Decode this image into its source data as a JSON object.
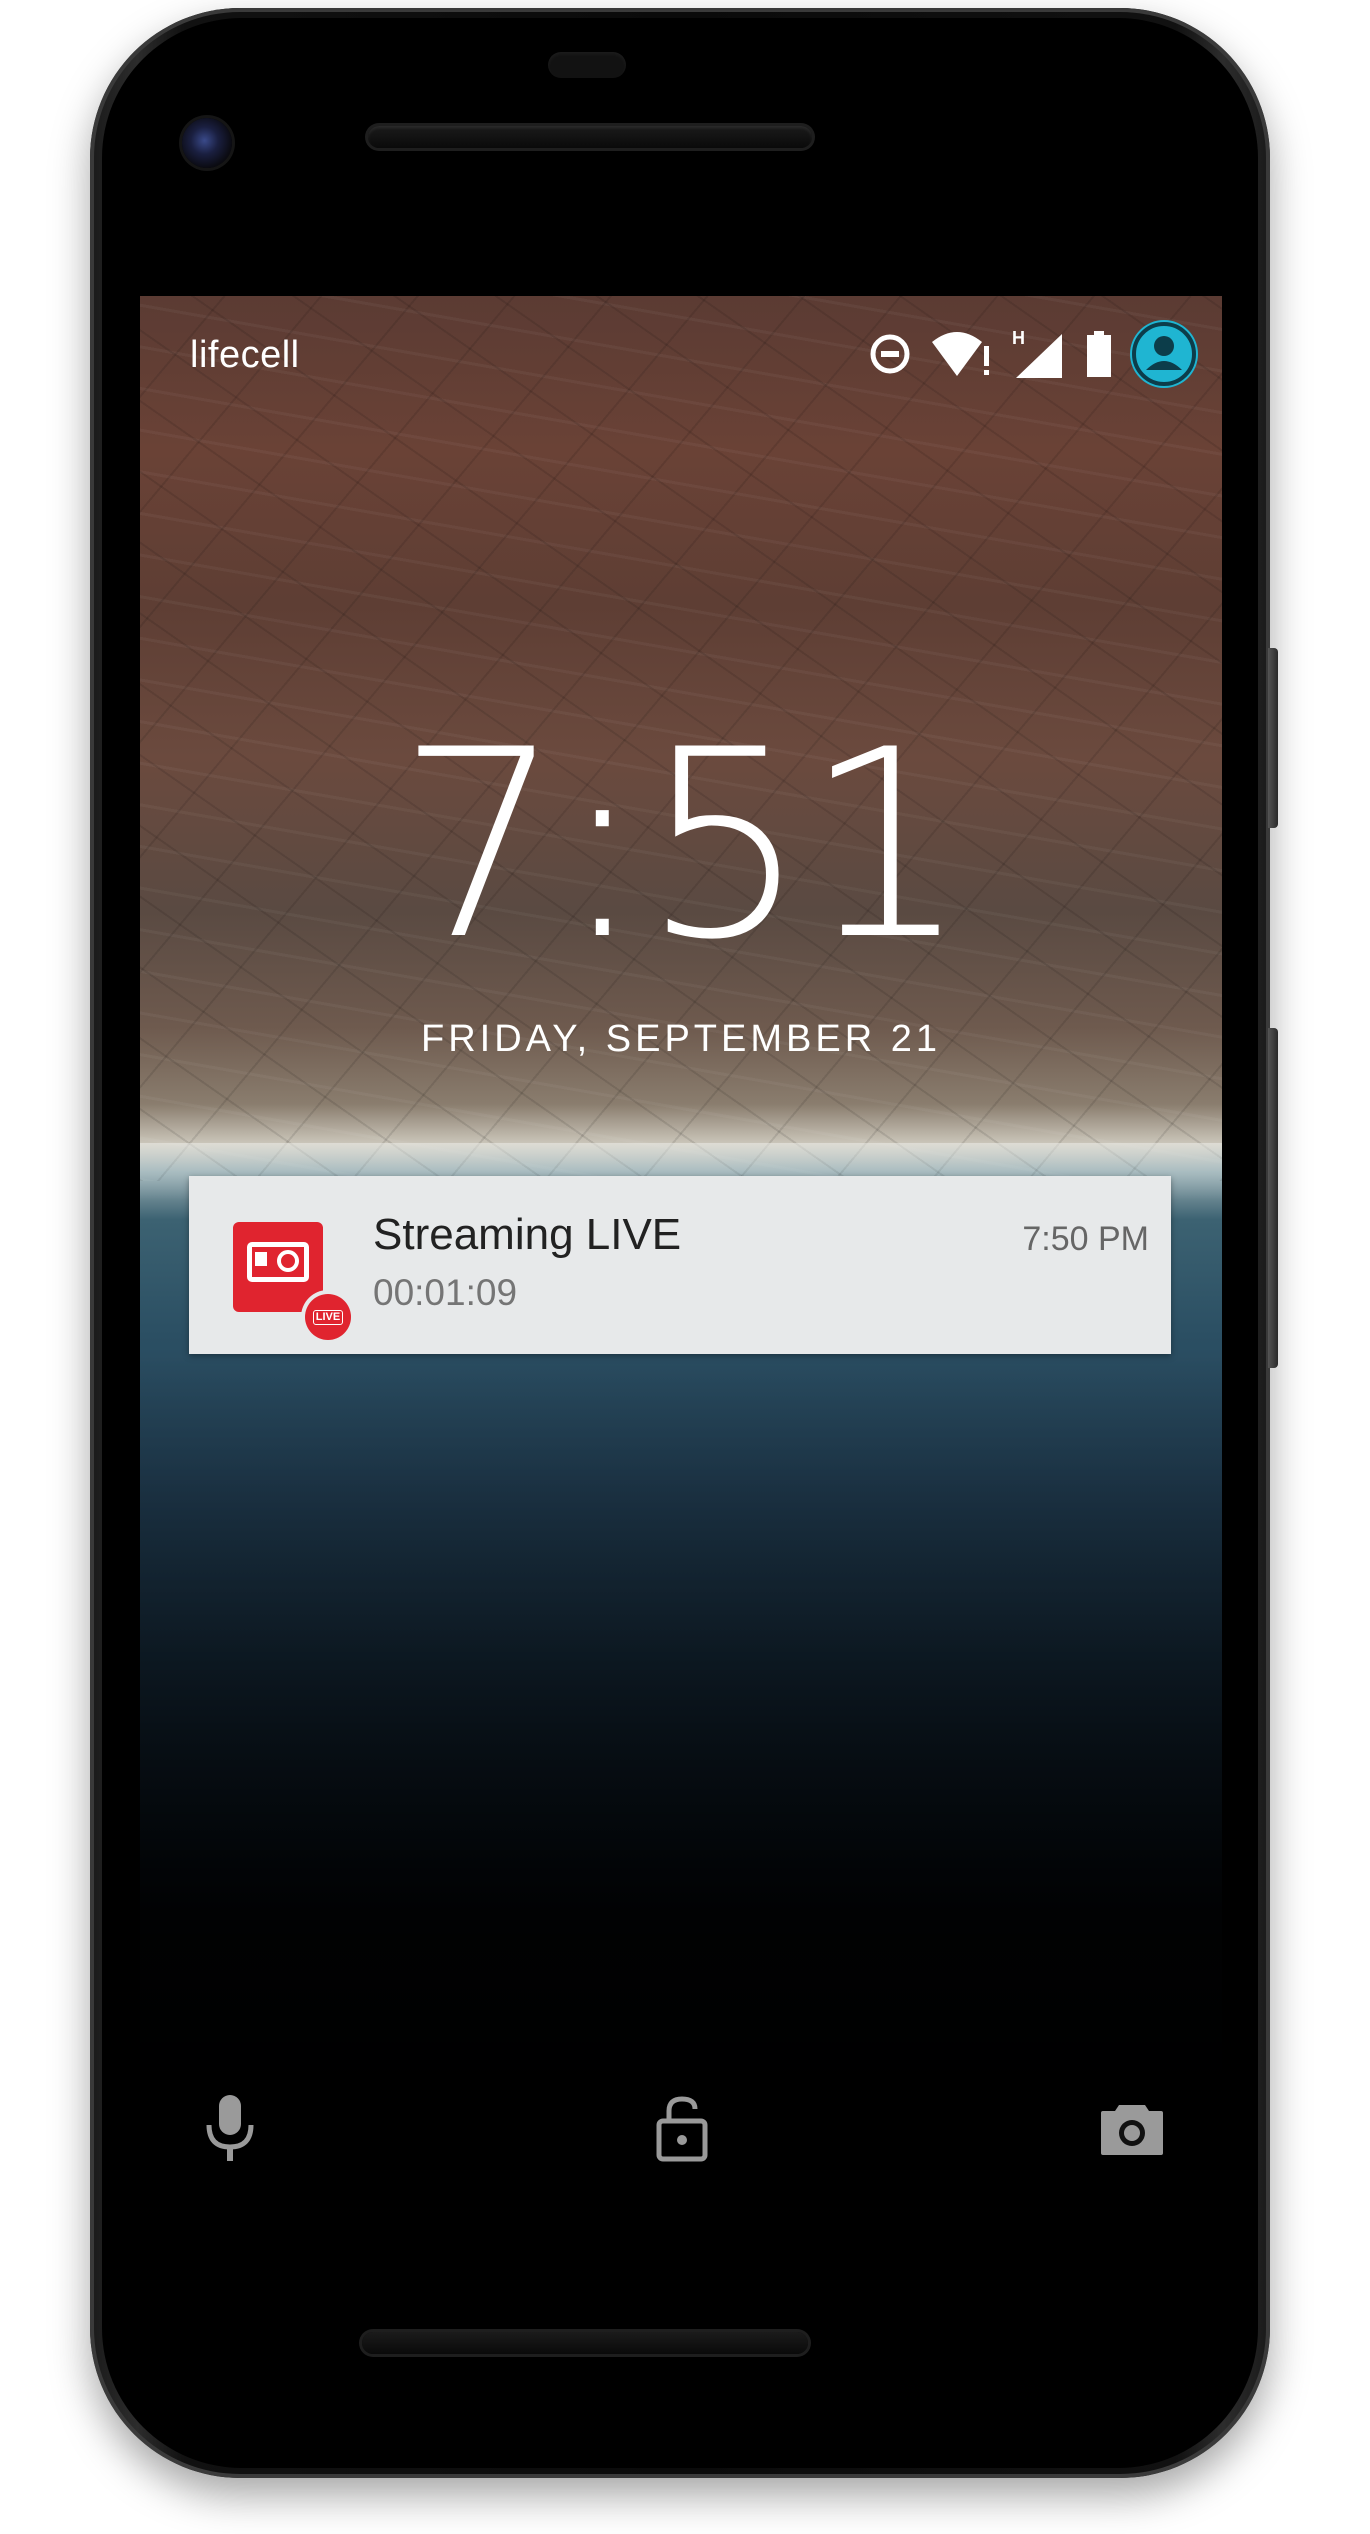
{
  "status_bar": {
    "carrier": "lifecell",
    "icons": [
      "do-not-disturb-icon",
      "wifi-alert-icon",
      "signal-h-icon",
      "battery-icon",
      "user-avatar-icon"
    ],
    "network_label": "H",
    "avatar_color": "#1fb5d2"
  },
  "lockscreen": {
    "time": "7:51",
    "date": "FRIDAY, SEPTEMBER 21"
  },
  "notification": {
    "app_icon": "live-stream-camera-icon",
    "badge_text": "LIVE",
    "title": "Streaming LIVE",
    "subtitle": "00:01:09",
    "time": "7:50 PM",
    "accent_color": "#e0242f"
  },
  "bottom_actions": {
    "left": "microphone-icon",
    "center": "unlock-icon",
    "right": "camera-icon"
  }
}
